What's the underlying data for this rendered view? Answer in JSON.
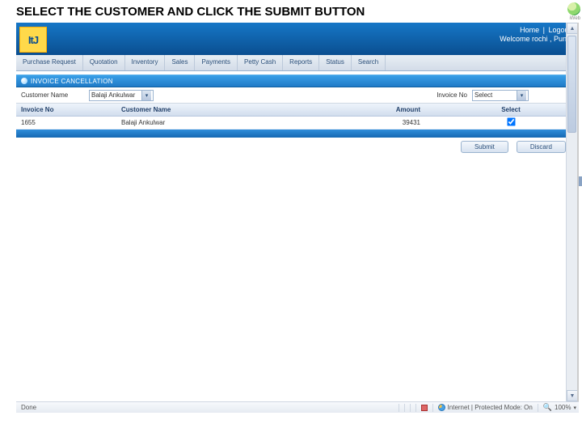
{
  "instruction": "SELECT THE CUSTOMER AND CLICK THE SUBMIT BUTTON",
  "brand": {
    "logo_text": "ItJ",
    "top_text": "iWeb"
  },
  "header": {
    "home": "Home",
    "logout": "Logout",
    "welcome": "Welcome  rochi , Pune"
  },
  "tabs": [
    "Purchase Request",
    "Quotation",
    "Inventory",
    "Sales",
    "Payments",
    "Petty Cash",
    "Reports",
    "Status",
    "Search"
  ],
  "section": {
    "title": "INVOICE CANCELLATION"
  },
  "filters": {
    "label_left": "Customer Name",
    "customer_selected": "Balaji Ankulwar",
    "label_right": "Invoice No",
    "invoice_selected": "Select"
  },
  "table": {
    "headers": {
      "invoice_no": "Invoice No",
      "customer_name": "Customer Name",
      "amount": "Amount",
      "select": "Select"
    },
    "rows": [
      {
        "invoice_no": "1655",
        "customer_name": "Balaji Ankulwar",
        "amount": "39431",
        "selected": true
      }
    ]
  },
  "actions": {
    "submit": "Submit",
    "discard": "Discard"
  },
  "statusbar": {
    "done": "Done",
    "zone": "Internet | Protected Mode: On",
    "zoom": "100%"
  }
}
